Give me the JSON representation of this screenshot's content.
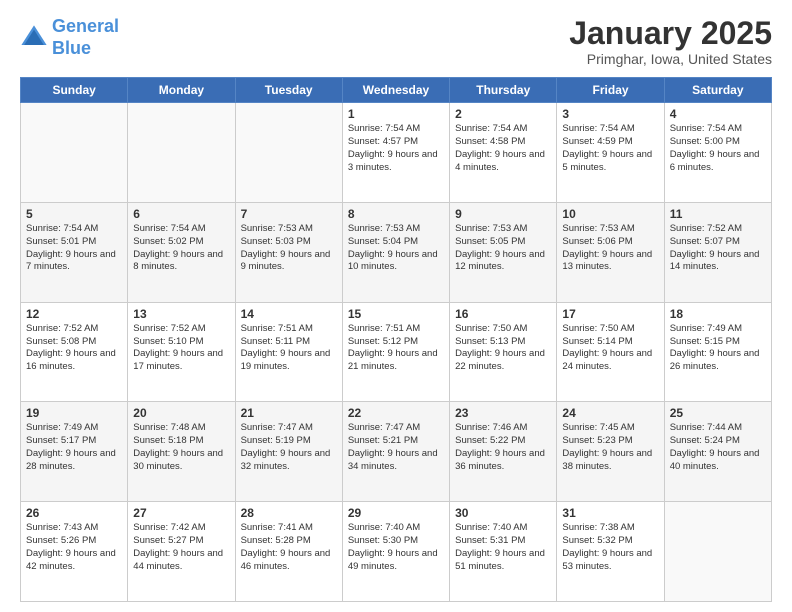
{
  "header": {
    "logo_line1": "General",
    "logo_line2": "Blue",
    "title": "January 2025",
    "subtitle": "Primghar, Iowa, United States"
  },
  "days_of_week": [
    "Sunday",
    "Monday",
    "Tuesday",
    "Wednesday",
    "Thursday",
    "Friday",
    "Saturday"
  ],
  "weeks": [
    [
      {
        "day": "",
        "info": ""
      },
      {
        "day": "",
        "info": ""
      },
      {
        "day": "",
        "info": ""
      },
      {
        "day": "1",
        "info": "Sunrise: 7:54 AM\nSunset: 4:57 PM\nDaylight: 9 hours and 3 minutes."
      },
      {
        "day": "2",
        "info": "Sunrise: 7:54 AM\nSunset: 4:58 PM\nDaylight: 9 hours and 4 minutes."
      },
      {
        "day": "3",
        "info": "Sunrise: 7:54 AM\nSunset: 4:59 PM\nDaylight: 9 hours and 5 minutes."
      },
      {
        "day": "4",
        "info": "Sunrise: 7:54 AM\nSunset: 5:00 PM\nDaylight: 9 hours and 6 minutes."
      }
    ],
    [
      {
        "day": "5",
        "info": "Sunrise: 7:54 AM\nSunset: 5:01 PM\nDaylight: 9 hours and 7 minutes."
      },
      {
        "day": "6",
        "info": "Sunrise: 7:54 AM\nSunset: 5:02 PM\nDaylight: 9 hours and 8 minutes."
      },
      {
        "day": "7",
        "info": "Sunrise: 7:53 AM\nSunset: 5:03 PM\nDaylight: 9 hours and 9 minutes."
      },
      {
        "day": "8",
        "info": "Sunrise: 7:53 AM\nSunset: 5:04 PM\nDaylight: 9 hours and 10 minutes."
      },
      {
        "day": "9",
        "info": "Sunrise: 7:53 AM\nSunset: 5:05 PM\nDaylight: 9 hours and 12 minutes."
      },
      {
        "day": "10",
        "info": "Sunrise: 7:53 AM\nSunset: 5:06 PM\nDaylight: 9 hours and 13 minutes."
      },
      {
        "day": "11",
        "info": "Sunrise: 7:52 AM\nSunset: 5:07 PM\nDaylight: 9 hours and 14 minutes."
      }
    ],
    [
      {
        "day": "12",
        "info": "Sunrise: 7:52 AM\nSunset: 5:08 PM\nDaylight: 9 hours and 16 minutes."
      },
      {
        "day": "13",
        "info": "Sunrise: 7:52 AM\nSunset: 5:10 PM\nDaylight: 9 hours and 17 minutes."
      },
      {
        "day": "14",
        "info": "Sunrise: 7:51 AM\nSunset: 5:11 PM\nDaylight: 9 hours and 19 minutes."
      },
      {
        "day": "15",
        "info": "Sunrise: 7:51 AM\nSunset: 5:12 PM\nDaylight: 9 hours and 21 minutes."
      },
      {
        "day": "16",
        "info": "Sunrise: 7:50 AM\nSunset: 5:13 PM\nDaylight: 9 hours and 22 minutes."
      },
      {
        "day": "17",
        "info": "Sunrise: 7:50 AM\nSunset: 5:14 PM\nDaylight: 9 hours and 24 minutes."
      },
      {
        "day": "18",
        "info": "Sunrise: 7:49 AM\nSunset: 5:15 PM\nDaylight: 9 hours and 26 minutes."
      }
    ],
    [
      {
        "day": "19",
        "info": "Sunrise: 7:49 AM\nSunset: 5:17 PM\nDaylight: 9 hours and 28 minutes."
      },
      {
        "day": "20",
        "info": "Sunrise: 7:48 AM\nSunset: 5:18 PM\nDaylight: 9 hours and 30 minutes."
      },
      {
        "day": "21",
        "info": "Sunrise: 7:47 AM\nSunset: 5:19 PM\nDaylight: 9 hours and 32 minutes."
      },
      {
        "day": "22",
        "info": "Sunrise: 7:47 AM\nSunset: 5:21 PM\nDaylight: 9 hours and 34 minutes."
      },
      {
        "day": "23",
        "info": "Sunrise: 7:46 AM\nSunset: 5:22 PM\nDaylight: 9 hours and 36 minutes."
      },
      {
        "day": "24",
        "info": "Sunrise: 7:45 AM\nSunset: 5:23 PM\nDaylight: 9 hours and 38 minutes."
      },
      {
        "day": "25",
        "info": "Sunrise: 7:44 AM\nSunset: 5:24 PM\nDaylight: 9 hours and 40 minutes."
      }
    ],
    [
      {
        "day": "26",
        "info": "Sunrise: 7:43 AM\nSunset: 5:26 PM\nDaylight: 9 hours and 42 minutes."
      },
      {
        "day": "27",
        "info": "Sunrise: 7:42 AM\nSunset: 5:27 PM\nDaylight: 9 hours and 44 minutes."
      },
      {
        "day": "28",
        "info": "Sunrise: 7:41 AM\nSunset: 5:28 PM\nDaylight: 9 hours and 46 minutes."
      },
      {
        "day": "29",
        "info": "Sunrise: 7:40 AM\nSunset: 5:30 PM\nDaylight: 9 hours and 49 minutes."
      },
      {
        "day": "30",
        "info": "Sunrise: 7:40 AM\nSunset: 5:31 PM\nDaylight: 9 hours and 51 minutes."
      },
      {
        "day": "31",
        "info": "Sunrise: 7:38 AM\nSunset: 5:32 PM\nDaylight: 9 hours and 53 minutes."
      },
      {
        "day": "",
        "info": ""
      }
    ]
  ]
}
